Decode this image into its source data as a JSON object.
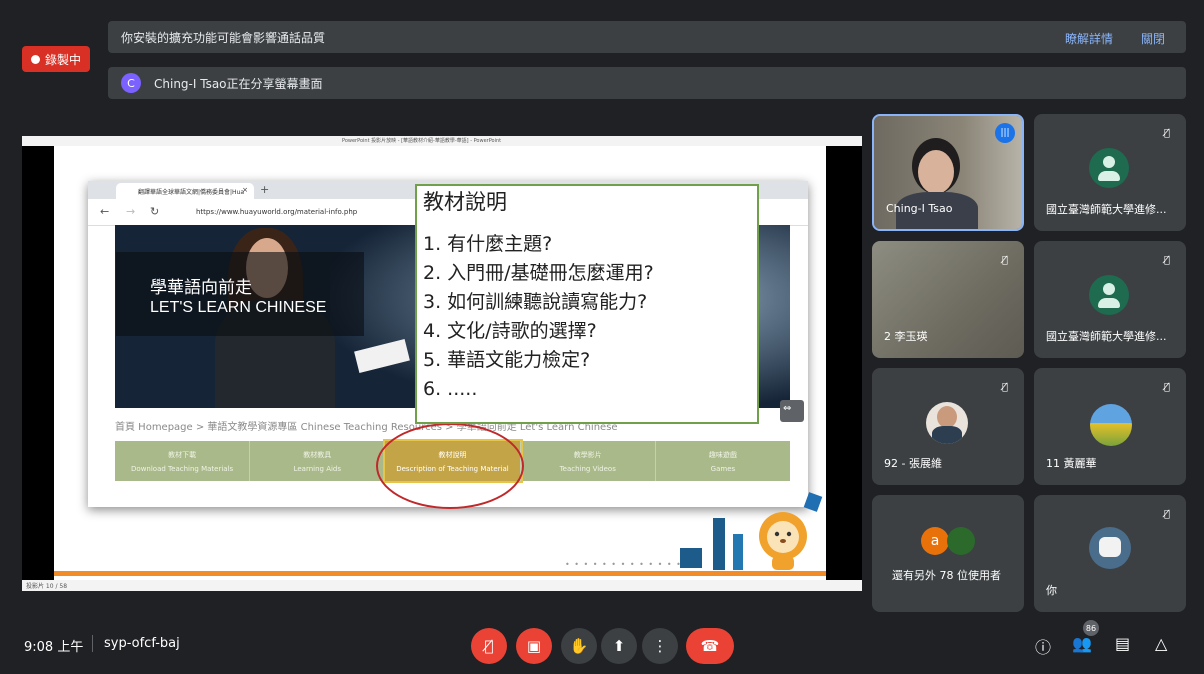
{
  "recording": {
    "label": "錄製中"
  },
  "banner_quality": {
    "message": "你安裝的擴充功能可能會影響通話品質",
    "learn_more": "瞭解詳情",
    "close": "關閉"
  },
  "banner_share": {
    "avatar_letter": "C",
    "message": "Ching-I Tsao正在分享螢幕畫面"
  },
  "presentation": {
    "window_title": "PowerPoint 投影片放映 - [華語教材介紹-華語教學-華語] - PowerPoint",
    "status_text": "投影片 10 / 58",
    "browser": {
      "tab_title": "翻譯華語全球華語文網|僑務委員會|Hua",
      "url": "https://www.huayuworld.org/material-info.php"
    },
    "hero": {
      "line1": "學華語向前走",
      "line2": "LET'S LEARN CHINESE"
    },
    "breadcrumb": "首頁 Homepage > 華語文教學資源專區 Chinese Teaching Resources > 學華語向前走 Let's Learn Chinese",
    "menu": [
      {
        "zh": "教材下載",
        "en": "Download Teaching Materials",
        "active": false
      },
      {
        "zh": "教材教具",
        "en": "Learning Aids",
        "active": false
      },
      {
        "zh": "教材說明",
        "en": "Description of Teaching Material",
        "active": true
      },
      {
        "zh": "教學影片",
        "en": "Teaching Videos",
        "active": false
      },
      {
        "zh": "趣味遊戲",
        "en": "Games",
        "active": false
      }
    ],
    "overlay": {
      "title": "教材說明",
      "items": [
        "1.  有什麼主題?",
        "2.  入門冊/基礎冊怎麼運用?",
        "3.  如何訓練聽說讀寫能力?",
        "4.  文化/詩歌的選擇?",
        "5.  華語文能力檢定?",
        "6.  ....."
      ]
    },
    "highlight_color": "#c0282a",
    "overlay_border_color": "#70a14a"
  },
  "participants": {
    "tiles": [
      {
        "name": "Ching-I Tsao",
        "kind": "camera-speaking"
      },
      {
        "name": "國立臺灣師範大學進修...",
        "kind": "avatar-muted"
      },
      {
        "name": "2 李玉瑛",
        "kind": "camera-muted"
      },
      {
        "name": "國立臺灣師範大學進修...",
        "kind": "avatar-muted"
      },
      {
        "name": "92 - 張展維",
        "kind": "photo-muted"
      },
      {
        "name": "11 黃麗華",
        "kind": "photo-muted"
      },
      {
        "name": "還有另外 78 位使用者",
        "kind": "more",
        "avatar_letter": "a"
      },
      {
        "name": "你",
        "kind": "self-muted"
      }
    ]
  },
  "bottom_bar": {
    "time": "9:08 上午",
    "meeting_code": "syp-ofcf-baj",
    "people_count": "86",
    "icons": [
      "mic-off-icon",
      "camera-off-icon",
      "raise-hand-icon",
      "present-icon",
      "more-options-icon",
      "end-call-icon",
      "info-icon",
      "people-icon",
      "chat-icon",
      "activities-icon"
    ]
  },
  "colors": {
    "background": "#202124",
    "banner": "#3c4043",
    "link": "#8ab4f8",
    "danger": "#ea4335",
    "accent": "#1a73e8"
  }
}
